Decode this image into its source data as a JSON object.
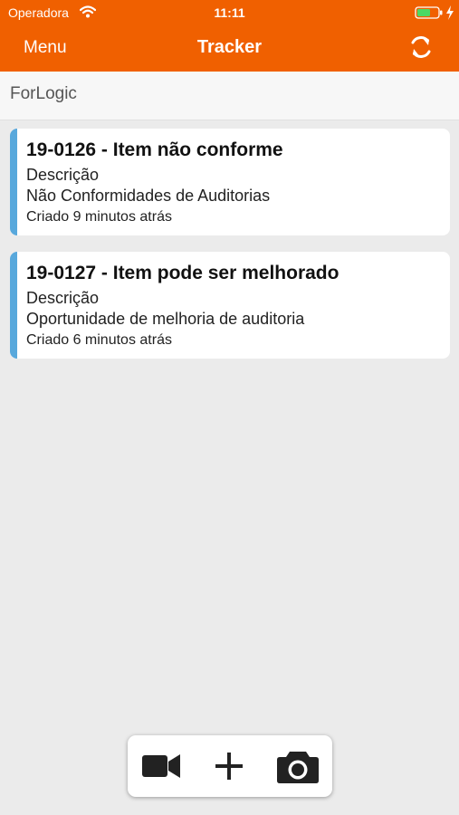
{
  "status_bar": {
    "carrier": "Operadora",
    "time": "11:11"
  },
  "nav": {
    "menu_label": "Menu",
    "title": "Tracker"
  },
  "org": {
    "name": "ForLogic"
  },
  "items": [
    {
      "title": "19-0126 - Item não conforme",
      "label": "Descrição",
      "description": "Não Conformidades de Auditorias",
      "created": "Criado 9 minutos atrás"
    },
    {
      "title": "19-0127 - Item pode ser melhorado",
      "label": "Descrição",
      "description": "Oportunidade de melhoria de auditoria",
      "created": "Criado 6 minutos atrás"
    }
  ],
  "toolbar": {
    "icons": [
      "video-camera-icon",
      "plus-icon",
      "camera-icon"
    ]
  },
  "colors": {
    "header": "#f06000",
    "accent_stripe": "#58a8dc",
    "background": "#ebebeb",
    "battery_fill": "#4cd964"
  }
}
